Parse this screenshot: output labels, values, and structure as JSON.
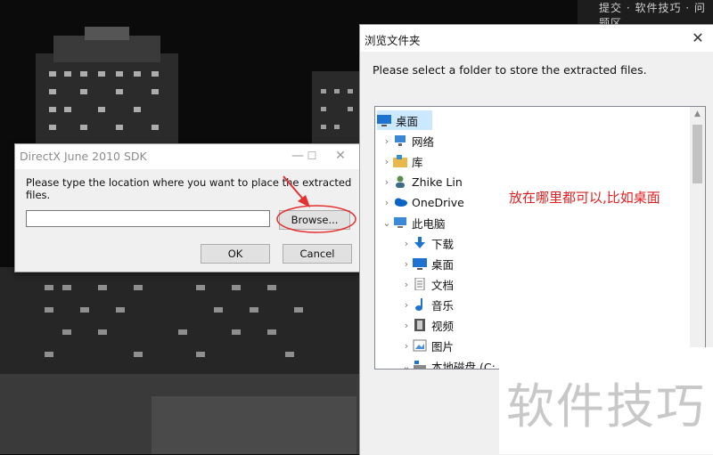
{
  "top_strip": {
    "text": "提交 · 软件技巧 · 问题区"
  },
  "directx_dialog": {
    "title": "DirectX June 2010 SDK",
    "prompt": "Please type the location where you want to place the extracted files.",
    "path_value": "",
    "browse_label": "Browse...",
    "ok_label": "OK",
    "cancel_label": "Cancel",
    "minimize_symbol": "—",
    "maximize_symbol": "☐",
    "close_symbol": "✕"
  },
  "browse_dialog": {
    "title": "浏览文件夹",
    "close_symbol": "✕",
    "message": "Please select a folder to store the extracted files.",
    "tree": [
      {
        "label": "桌面",
        "icon": "desktop-icon",
        "selected": true,
        "level": 0,
        "expander": ""
      },
      {
        "label": "网络",
        "icon": "network-icon",
        "level": 1,
        "expander": "›"
      },
      {
        "label": "库",
        "icon": "library-icon",
        "level": 1,
        "expander": "›"
      },
      {
        "label": "Zhike Lin",
        "icon": "user-icon",
        "level": 1,
        "expander": "›"
      },
      {
        "label": "OneDrive",
        "icon": "onedrive-icon",
        "level": 1,
        "expander": "›"
      },
      {
        "label": "此电脑",
        "icon": "computer-icon",
        "level": 1,
        "expander": "⌄"
      },
      {
        "label": "下载",
        "icon": "download-icon",
        "level": 2,
        "expander": "›"
      },
      {
        "label": "桌面",
        "icon": "desktop-icon",
        "level": 2,
        "expander": "›"
      },
      {
        "label": "文档",
        "icon": "document-icon",
        "level": 2,
        "expander": "›"
      },
      {
        "label": "音乐",
        "icon": "music-icon",
        "level": 2,
        "expander": "›"
      },
      {
        "label": "视频",
        "icon": "video-icon",
        "level": 2,
        "expander": "›"
      },
      {
        "label": "图片",
        "icon": "picture-icon",
        "level": 2,
        "expander": "›"
      },
      {
        "label": "本地磁盘 (C:",
        "icon": "disk-icon",
        "level": 2,
        "expander": "⌄"
      }
    ]
  },
  "annotation": "放在哪里都可以,比如桌面",
  "watermark": "软件技巧",
  "colors": {
    "annotation_red": "#e02020",
    "selection": "#cce8ff",
    "highlight_oval": "#e53030"
  }
}
